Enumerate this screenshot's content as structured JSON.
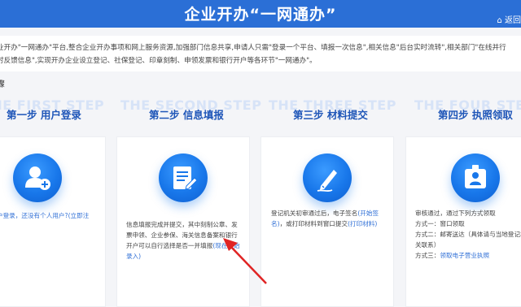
{
  "header": {
    "title": "企业开办“一网通办”",
    "back_label": "返回"
  },
  "intro": {
    "line1": "业开办\"一网通办\"平台,整合企业开办事项和网上服务资源,加强部门信息共享,申请人只需\"登录一个平台、填报一次信息\",相关信息\"后台实时流转\",相关部门\"在线并行",
    "line2": "时反馈信息\",实现开办企业设立登记、社保登记、印章刻制、申领发票和银行开户等各环节\"一网通办\"。"
  },
  "section_title": "骤",
  "steps": [
    {
      "ghost": "THE FIRST STEP",
      "title": "第一步 用户登录",
      "icon": "user-add-icon",
      "desc_1": "户登录，还没有个人用户?",
      "desc_link": "(立即注"
    },
    {
      "ghost": "THE SECOND STEP",
      "title": "第二步 信息填报",
      "icon": "form-edit-icon",
      "desc_1": "信息填报完成并提交，其中刻制公章、发",
      "desc_2": "票申领、企业参保、海关信息备案和银行",
      "desc_3": "开户可以自行选择是否一并填报",
      "desc_link_a": "(现在开始",
      "desc_link_b": "录入)"
    },
    {
      "ghost": "THE THREE STEP",
      "title": "第三步 材料提交",
      "icon": "pen-sign-icon",
      "desc_1": "登记机关初审通过后，电子签名",
      "desc_link_a": "(开始签",
      "desc_2a": "名)",
      "desc_2b": "，或打印材料到窗口提交",
      "desc_link_b": "(打印材料)"
    },
    {
      "ghost": "THE FOUR STEP",
      "title": "第四步 执照领取",
      "icon": "id-card-icon",
      "line1": "审核通过，通过下列方式领取",
      "line2": "方式一：窗口领取",
      "line3": "方式二：邮寄送达（具体请与当地登记机",
      "line4": "关联系）",
      "line5_prefix": "方式三：",
      "line5_link": "领取电子营业执照"
    }
  ],
  "colors": {
    "header_blue": "#2b6fd6",
    "step_title_blue": "#1f56b8",
    "link_blue": "#2f6fd6",
    "arrow_red": "#e02424"
  }
}
